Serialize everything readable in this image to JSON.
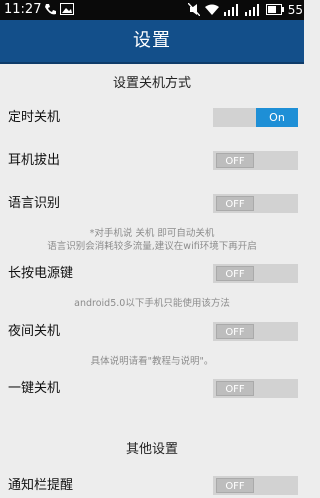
{
  "status_bar": {
    "time": "11:27",
    "left_icons": [
      "phone-icon",
      "gallery-icon"
    ],
    "right_icons": [
      "mute-icon",
      "wifi-icon",
      "signal-icon",
      "signal-icon",
      "battery-icon"
    ],
    "battery_percent": "55"
  },
  "title_bar": {
    "title": "设置"
  },
  "sections": [
    {
      "header": "设置关机方式",
      "rows": [
        {
          "label": "定时关机",
          "toggle": "On",
          "on": true
        },
        {
          "label": "耳机拔出",
          "toggle": "OFF",
          "on": false
        },
        {
          "label": "语言识别",
          "toggle": "OFF",
          "on": false,
          "note": [
            "*对手机说 关机 即可自动关机",
            "语言识别会消耗较多流量,建议在wifi环境下再开启"
          ]
        },
        {
          "label": "长按电源键",
          "toggle": "OFF",
          "on": false,
          "note": [
            "android5.0以下手机只能使用该方法"
          ]
        },
        {
          "label": "夜间关机",
          "toggle": "OFF",
          "on": false,
          "note": [
            "具体说明请看\"教程与说明\"。"
          ]
        },
        {
          "label": "一键关机",
          "toggle": "OFF",
          "on": false
        }
      ]
    },
    {
      "header": "其他设置",
      "rows": [
        {
          "label": "通知栏提醒",
          "toggle": "OFF",
          "on": false
        }
      ]
    }
  ],
  "colors": {
    "title_bar": "#134f8a",
    "toggle_on": "#1e8fd6",
    "background": "#ededed"
  }
}
